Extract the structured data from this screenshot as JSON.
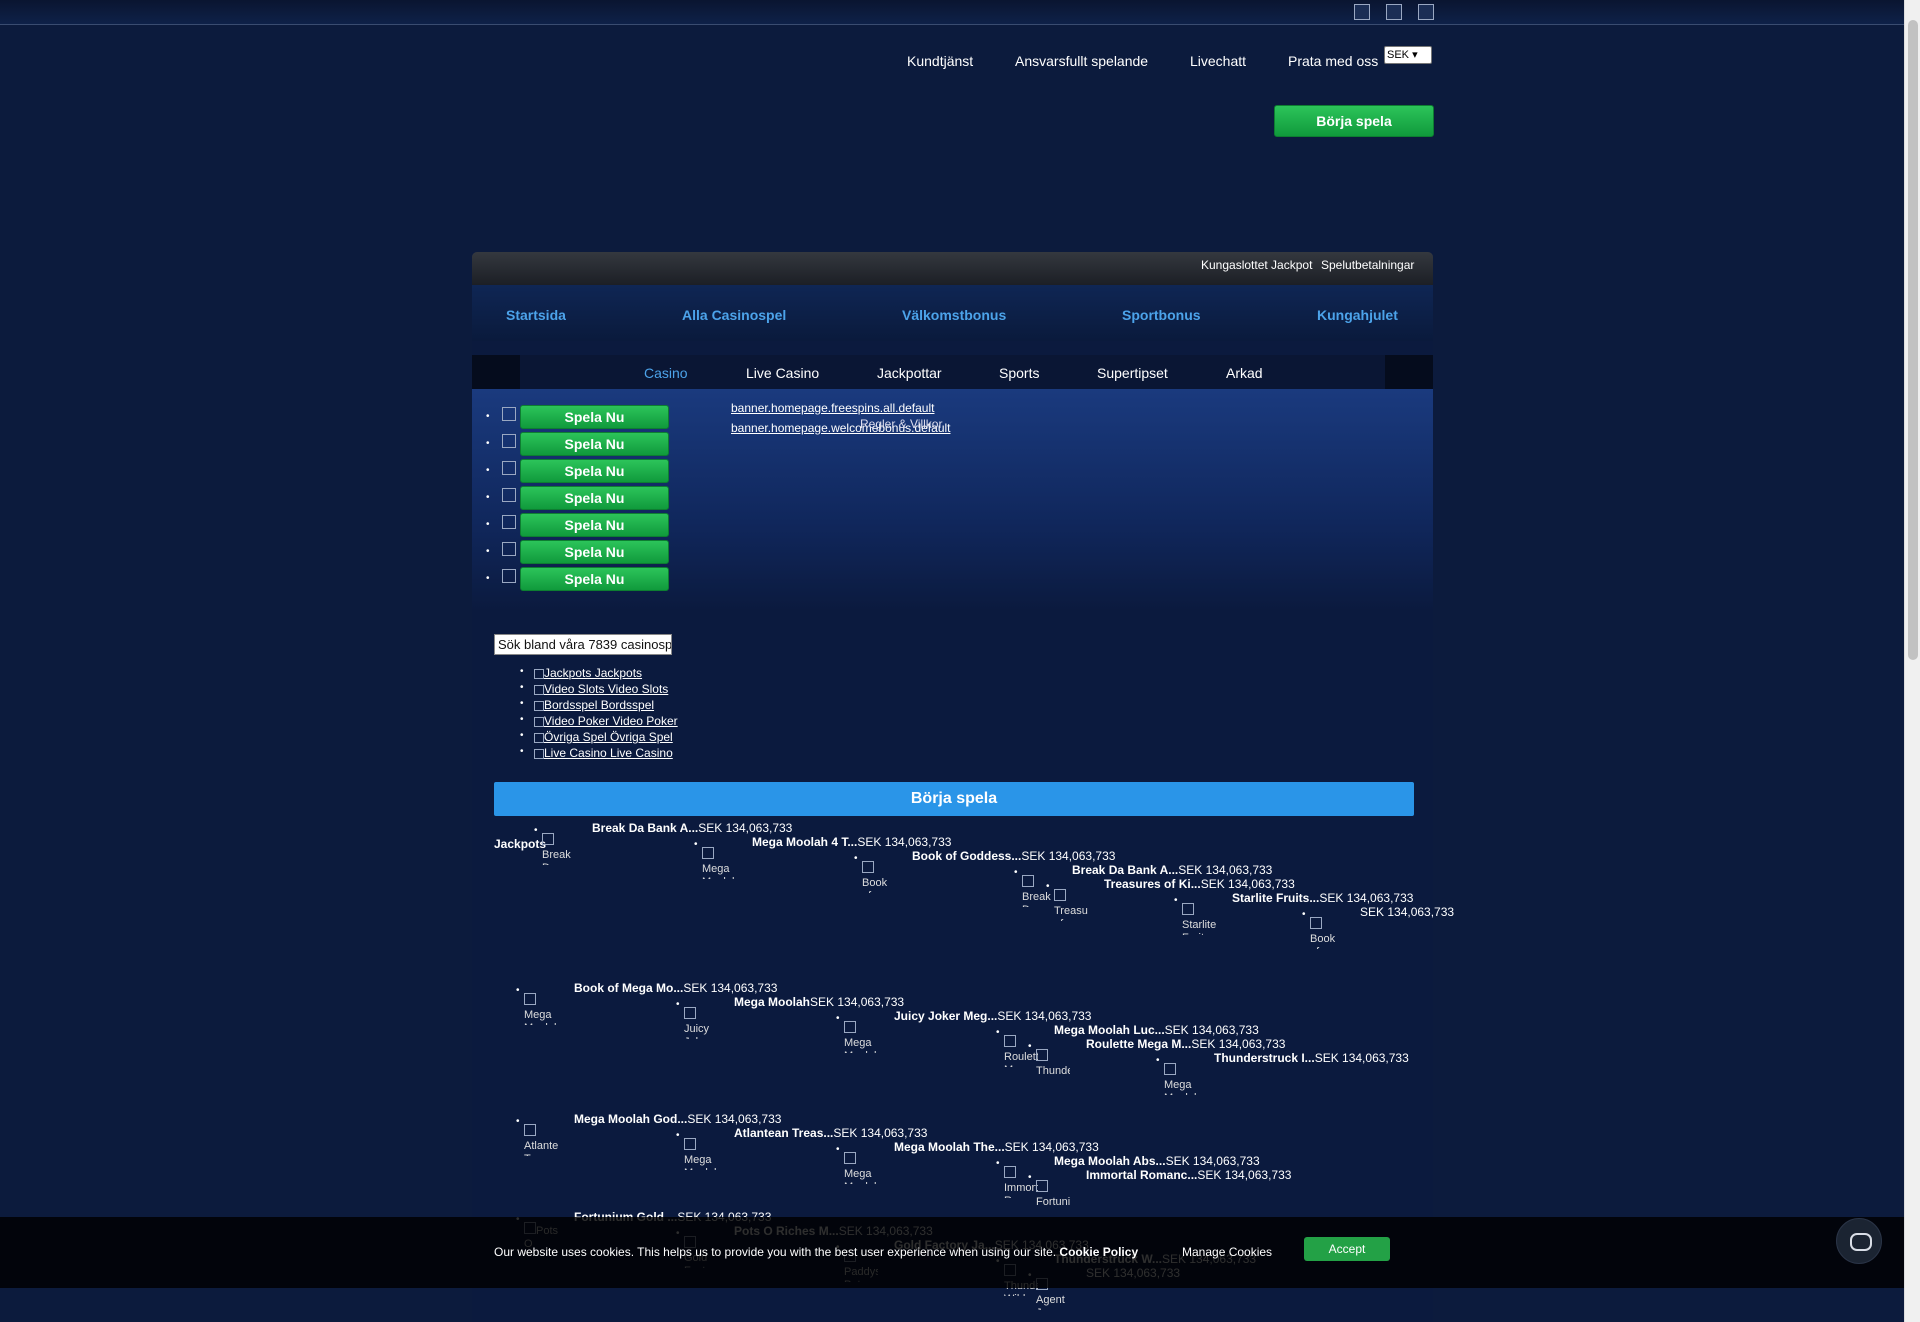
{
  "top_nav": {
    "links": [
      "Kundtjänst",
      "Ansvarsfullt spelande",
      "Livechatt",
      "Prata med oss"
    ],
    "currency": "SEK",
    "start_button": "Börja spela"
  },
  "util_bar": [
    "Kungaslottet Jackpot",
    "Spelutbetalningar"
  ],
  "main_nav": [
    "Startsida",
    "Alla Casinospel",
    "Välkomstbonus",
    "Sportbonus",
    "Kungahjulet"
  ],
  "sub_nav": [
    "Casino",
    "Live Casino",
    "Jackpottar",
    "Sports",
    "Supertipset",
    "Arkad"
  ],
  "banner": {
    "play_label": "Spela Nu",
    "links": [
      "banner.homepage.freespins.all.default",
      "banner.homepage.welcomebonus.default"
    ],
    "terms": "Regler & Villkor"
  },
  "search": {
    "placeholder": "Sök bland våra 7839 casinospel"
  },
  "categories": [
    "Jackpots Jackpots",
    "Video Slots Video Slots",
    "Bordsspel Bordsspel",
    "Video Poker Video Poker",
    "Övriga Spel Övriga Spel",
    "Live Casino Live Casino"
  ],
  "start_bar": "Börja spela",
  "jackpots_heading": "Jackpots",
  "jackpot_amount": "SEK 134,063,733",
  "games_row1": [
    {
      "name": "Break Da Bank A...",
      "img": "Break Da"
    },
    {
      "name": "Mega Moolah 4 T...",
      "img": "Mega Moolah"
    },
    {
      "name": "Book of Goddess...",
      "img": "Book of"
    },
    {
      "name": "Break Da Bank A...",
      "img": "Break Da"
    },
    {
      "name": "Treasures of Ki...",
      "img": "Treasu of"
    },
    {
      "name": "Starlite Fruits...",
      "img": "Starlite Fruits"
    },
    {
      "name": "",
      "img": "Book of"
    }
  ],
  "games_row2": [
    {
      "name": "Book of Mega Mo...",
      "img": "Mega Moolah"
    },
    {
      "name": "Mega Moolah",
      "img": "Juicy Joker"
    },
    {
      "name": "Juicy Joker Meg...",
      "img": "Mega Moolah"
    },
    {
      "name": "Mega Moolah Luc...",
      "img": "Roulette Mega"
    },
    {
      "name": "Roulette Mega M...",
      "img": "Thunde"
    },
    {
      "name": "Thunderstruck I...",
      "img": "Mega Moolah"
    }
  ],
  "games_row3": [
    {
      "name": "Mega Moolah God...",
      "img": "Atlantea Treasu"
    },
    {
      "name": "Atlantean Treas...",
      "img": "Mega Moolah"
    },
    {
      "name": "Mega Moolah The...",
      "img": "Mega Moolah"
    },
    {
      "name": "Mega Moolah Abs...",
      "img": "Immorta Roman"
    },
    {
      "name": "Immortal Romanc...",
      "img": "Fortuni"
    }
  ],
  "games_row4": [
    {
      "name": "Fortunium Gold ...",
      "img": "Pots O Riches"
    },
    {
      "name": "Pots O Riches M...",
      "img": "Gold Factory"
    },
    {
      "name": "Gold Factory Ja...",
      "img": "Paddys Pot"
    },
    {
      "name": "Thunderstruck W...",
      "img": "Thunde Wild"
    },
    {
      "name": "",
      "img": "Agent Jane"
    }
  ],
  "cookie": {
    "message": "Our website uses cookies. This helps us to provide you with the best user experience when using our site.",
    "policy": "Cookie Policy",
    "manage": "Manage Cookies",
    "accept": "Accept"
  }
}
